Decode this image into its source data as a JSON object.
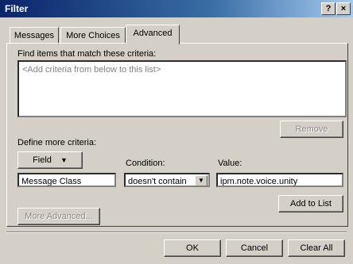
{
  "window": {
    "title": "Filter",
    "help_icon": "?",
    "close_icon": "×"
  },
  "tabs": [
    {
      "label": "Messages"
    },
    {
      "label": "More Choices"
    },
    {
      "label": "Advanced"
    }
  ],
  "criteria": {
    "heading": "Find items that match these criteria:",
    "placeholder": "<Add criteria from below to this list>",
    "remove_label": "Remove"
  },
  "define": {
    "heading": "Define more criteria:",
    "field_button": "Field",
    "condition_label": "Condition:",
    "value_label": "Value:",
    "field_value": "Message Class",
    "condition_value": "doesn't contain",
    "value_value": "ipm.note.voice.unity",
    "add_label": "Add to List",
    "more_advanced_label": "More Advanced..."
  },
  "footer": {
    "ok_label": "OK",
    "cancel_label": "Cancel",
    "clear_all_label": "Clear All"
  }
}
